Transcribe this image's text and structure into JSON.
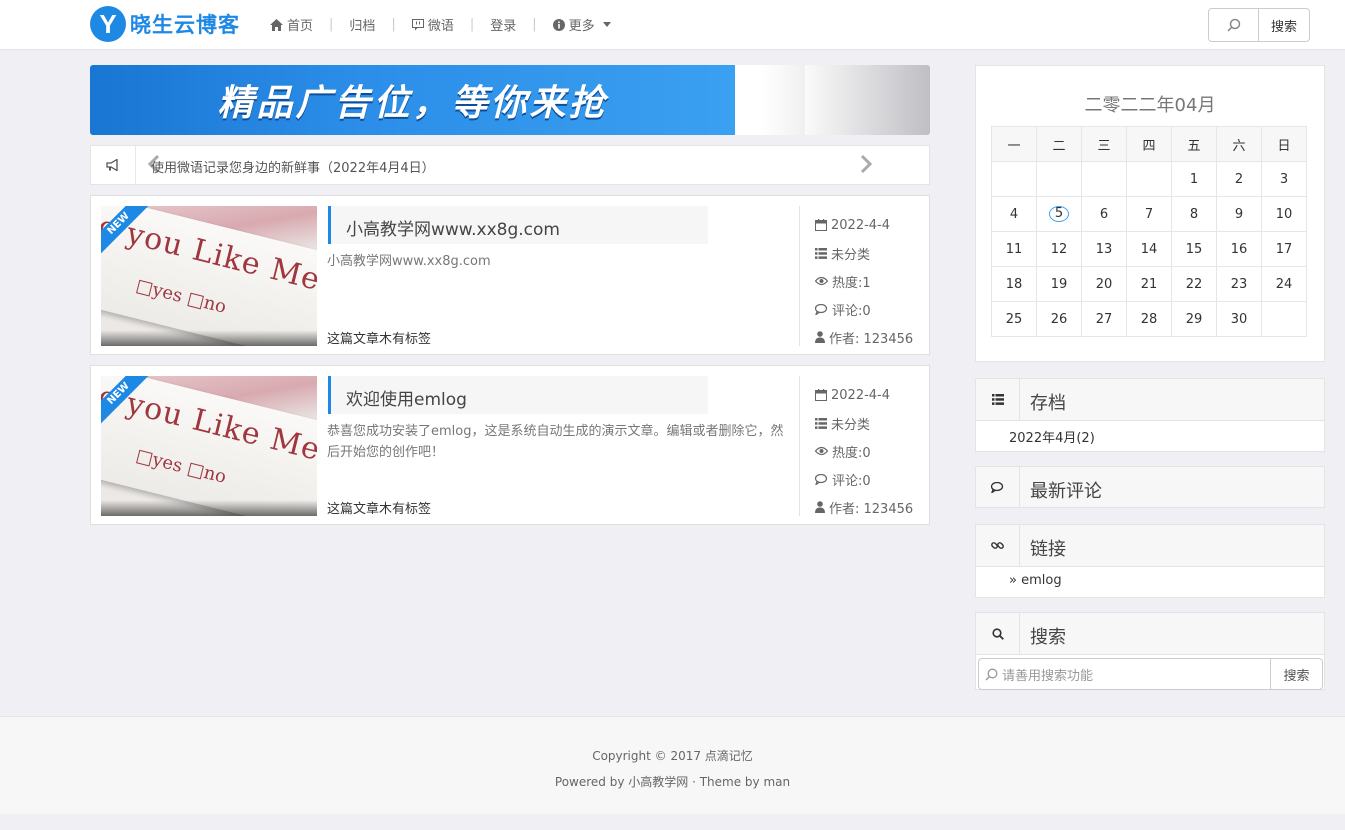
{
  "header": {
    "logo_letter": "Y",
    "logo_text": "晓生云博客",
    "nav": [
      {
        "label": "首页",
        "icon": "home-icon"
      },
      {
        "label": "归档"
      },
      {
        "label": "微语",
        "icon": "chat-icon"
      },
      {
        "label": "登录"
      },
      {
        "label": "更多",
        "icon": "info-icon"
      }
    ],
    "search_button": "搜索"
  },
  "banner": {
    "text": "精品广告位，等你来抢"
  },
  "notice": {
    "text": "使用微语记录您身边的新鲜事（2022年4月4日）"
  },
  "posts": [
    {
      "badge": "NEW",
      "thumb_text": "o you Like Me?",
      "thumb_options": "□yes  □no",
      "title": "小高教学网www.xx8g.com",
      "excerpt": "小高教学网www.xx8g.com",
      "tags": "这篇文章木有标签",
      "date": "2022-4-4",
      "category": "未分类",
      "views": "热度:1",
      "comments": "评论:0",
      "author": "作者: 123456"
    },
    {
      "badge": "NEW",
      "thumb_text": "o you Like Me?",
      "thumb_options": "□yes  □no",
      "title": "欢迎使用emlog",
      "excerpt": "恭喜您成功安装了emlog，这是系统自动生成的演示文章。编辑或者删除它，然后开始您的创作吧！",
      "tags": "这篇文章木有标签",
      "date": "2022-4-4",
      "category": "未分类",
      "views": "热度:0",
      "comments": "评论:0",
      "author": "作者: 123456"
    }
  ],
  "calendar": {
    "title": "二零二二年04月",
    "weekdays": [
      "一",
      "二",
      "三",
      "四",
      "五",
      "六",
      "日"
    ],
    "weeks": [
      [
        "",
        "",
        "",
        "",
        "1",
        "2",
        "3"
      ],
      [
        "4",
        "5",
        "6",
        "7",
        "8",
        "9",
        "10"
      ],
      [
        "11",
        "12",
        "13",
        "14",
        "15",
        "16",
        "17"
      ],
      [
        "18",
        "19",
        "20",
        "21",
        "22",
        "23",
        "24"
      ],
      [
        "25",
        "26",
        "27",
        "28",
        "29",
        "30",
        ""
      ]
    ],
    "today": "5"
  },
  "sidebar": {
    "archive": {
      "title": "存档",
      "item": "2022年4月(2)"
    },
    "comments": {
      "title": "最新评论"
    },
    "links": {
      "title": "链接",
      "item": "» emlog"
    },
    "search": {
      "title": "搜索",
      "placeholder": "请善用搜索功能",
      "button": "搜索"
    }
  },
  "footer": {
    "line1": "Copyright © 2017 点滴记忆",
    "line2": "Powered by 小高教学网 · Theme by man"
  },
  "colors": {
    "accent": "#1e88e5"
  }
}
